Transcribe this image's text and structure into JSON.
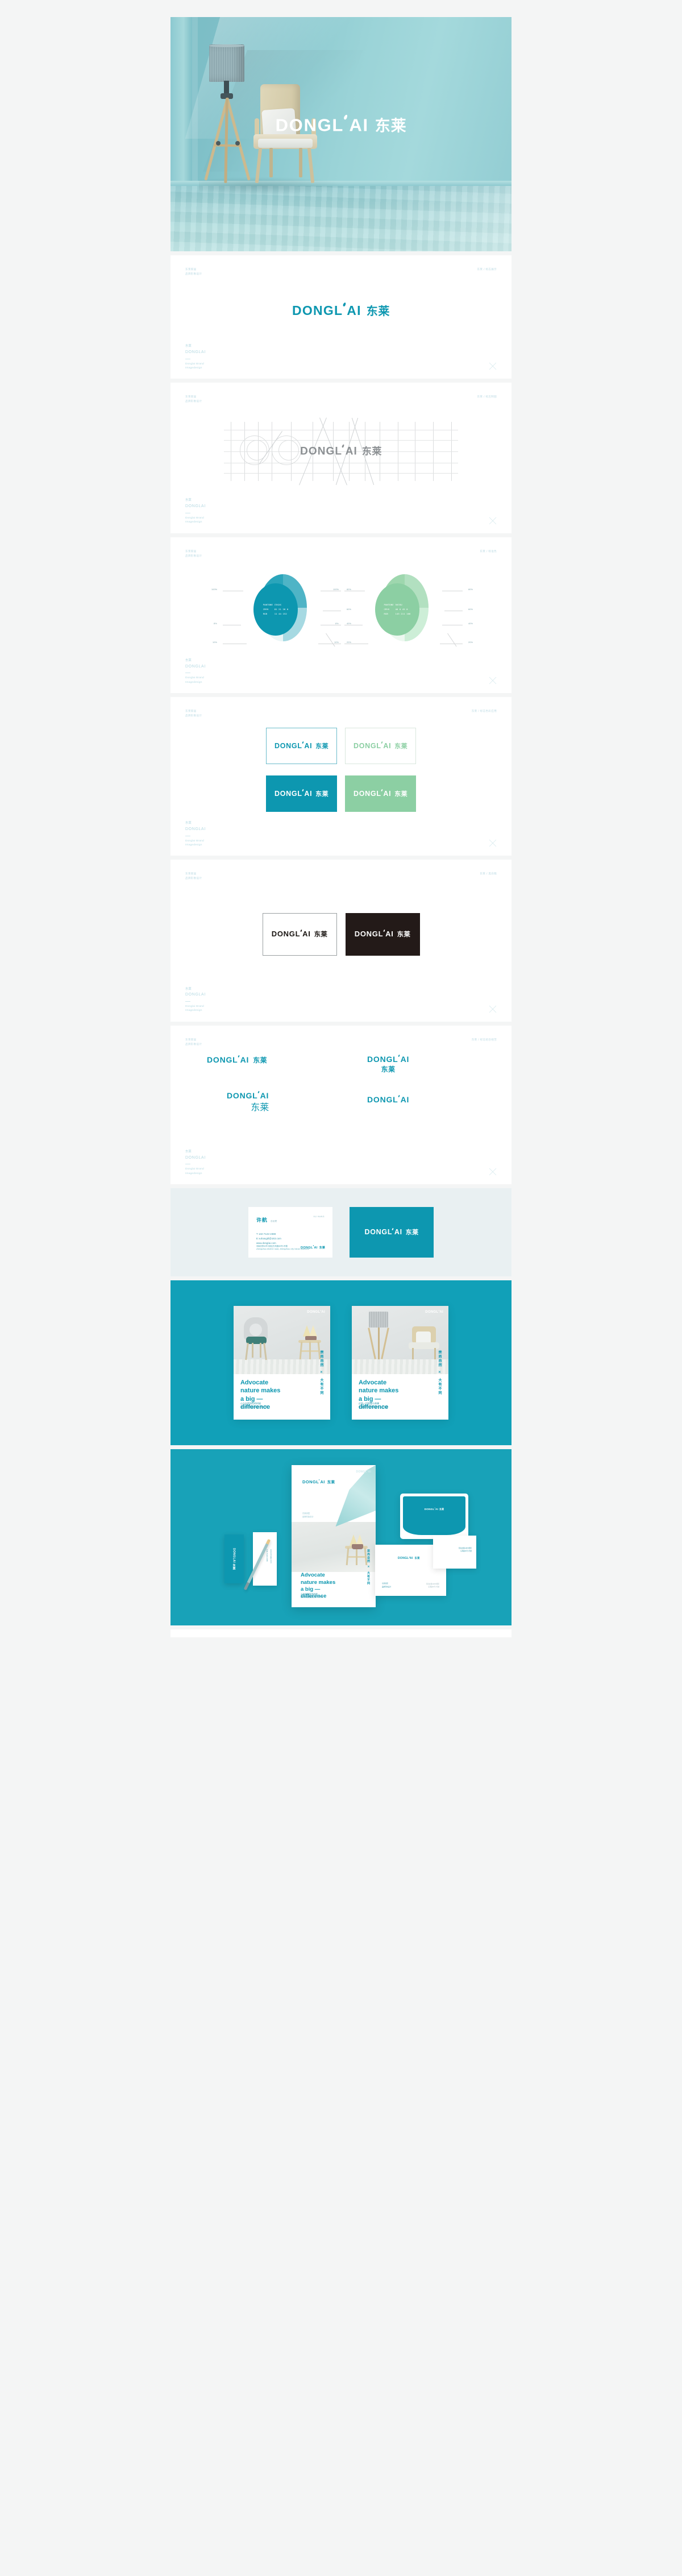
{
  "brand": {
    "latin": "DONGLAI",
    "cjk": "东莱",
    "accent_teal": "#0d97b0",
    "accent_green": "#8ccfa3",
    "dark": "#231a18",
    "page_bg": "#f4f5f5"
  },
  "hero": {
    "logo_latin": "DONGLAI",
    "logo_cjk": "东莱",
    "alt": "teal interior room with floor lamp and armchair"
  },
  "sheet_header": {
    "left_line1": "东莱家居",
    "left_line2": "品牌形象设计",
    "right_logo": "东莱 / 标志展示",
    "right_grid": "东莱 / 标志制图",
    "right_color": "东莱 / 标准色",
    "right_variants": "东莱 / 标志色彩应用",
    "right_bw": "东莱 / 黑白稿",
    "right_lockup": "东莱 / 标志组合规范"
  },
  "sheet_footer": {
    "cn": "东莱",
    "en": "DONGLAI",
    "sub_line1": "Donglai Brand",
    "sub_line2": "Imagedesign",
    "mark": "x-mark-icon"
  },
  "panels": {
    "logo": {
      "title": "标志展示"
    },
    "grid": {
      "title": "标志制图"
    },
    "color": {
      "title": "标准色",
      "swatches": [
        {
          "name": "primary-teal",
          "hex": "#0d97b0",
          "pantone_label": "PANTONE",
          "pantone_value": "C9XXX",
          "cmyk_label": "CMYK",
          "cmyk_value": "81 21 26 0",
          "rgb_label": "RGB",
          "rgb_value": "11 44 152",
          "left_ticks": [
            "100%",
            "8%",
            "10%"
          ],
          "right_ticks": [
            "80%",
            "60%",
            "40%",
            "20%"
          ]
        },
        {
          "name": "secondary-green",
          "hex": "#8ccfa3",
          "pantone_label": "PANTONE",
          "pantone_value": "5635U",
          "cmyk_label": "CMYK",
          "cmyk_value": "46 0 45 0",
          "rgb_label": "RGB",
          "rgb_value": "145 211 166",
          "left_ticks": [
            "100%",
            "8%",
            "10%"
          ],
          "right_ticks": [
            "80%",
            "60%",
            "40%",
            "20%"
          ]
        }
      ]
    },
    "variants": {
      "title": "标志色彩应用",
      "boxes": [
        {
          "name": "teal-on-white",
          "bg": "#ffffff",
          "fg": "#0d97b0",
          "border": "#6bbccb"
        },
        {
          "name": "green-on-white",
          "bg": "#ffffff",
          "fg": "#8ccfa3",
          "border": "#d9e7dd"
        },
        {
          "name": "white-on-teal",
          "bg": "#0d97b0",
          "fg": "#ffffff",
          "border": "transparent"
        },
        {
          "name": "white-on-green",
          "bg": "#8ccfa3",
          "fg": "#ffffff",
          "border": "transparent"
        }
      ]
    },
    "bw": {
      "title": "黑白稿",
      "boxes": [
        {
          "name": "black-on-white",
          "bg": "#ffffff",
          "fg": "#1a1512",
          "border": "#9aa0a2"
        },
        {
          "name": "white-on-black",
          "bg": "#231a18",
          "fg": "#ffffff",
          "border": "transparent"
        }
      ]
    },
    "lockups": {
      "title": "标志组合规范",
      "items": [
        {
          "name": "horizontal-lockup",
          "layout": "horizontal",
          "latin": "DONGLAI",
          "cjk": "东莱"
        },
        {
          "name": "stacked-centered-lockup",
          "layout": "stacked",
          "latin": "DONGLAI",
          "cjk": "东莱"
        },
        {
          "name": "stacked-right-lockup",
          "layout": "stacked-right",
          "latin": "DONGLAI",
          "cjk": "东莱"
        },
        {
          "name": "latin-only-lockup",
          "layout": "latin-only",
          "latin": "DONGLAI",
          "cjk": ""
        }
      ]
    },
    "business_card": {
      "name_cjk": "许航",
      "role": "总经理",
      "name_pinyin": "XU HANG",
      "phone": "T  132-7122-2388",
      "email": "E  xuhangdl@163.com",
      "website": "www.donglai.com",
      "address_cn": "河南省郑州市中原区东风路66号1号楼",
      "address_en": "zhengzhou district road, zhengzhou city henan province",
      "back_latin": "DONGLAI",
      "back_cjk": "东莱"
    },
    "posters": {
      "headline_line1": "Advocate",
      "headline_line2": "nature makes",
      "headline_line3": "a big —",
      "headline_line4": "difference",
      "vertical_left": "崇尚自然",
      "vertical_x": "×",
      "vertical_right": "大有不同",
      "logo": "DONGLAI",
      "items": [
        {
          "name": "poster-chair",
          "sub_line1": "心与自然同在的时候",
          "sub_line2": "我们永远都会找到一种宁静"
        },
        {
          "name": "poster-lamp",
          "sub_line1": "远离一切喧嚣与束缚",
          "sub_line2": "在慢慢的世界里保持几分宁静"
        }
      ]
    },
    "stationery": {
      "flyer_logo_latin": "DONGLAI",
      "flyer_logo_cjk": "东莱",
      "flyer_headline_line1": "Advocate",
      "flyer_headline_line2": "nature makes",
      "flyer_headline_line3": "a big —",
      "flyer_headline_line4": "difference",
      "flyer_sub_line1": "心与自然同在的时候",
      "flyer_sub_line2": "我们永远都会找到一种宁静",
      "flyer_vertical_left": "崇尚自然",
      "flyer_vertical_x": "×",
      "flyer_vertical_right": "大有不同",
      "card_vertical": "DONGLAI 东莱",
      "envelope_latin": "DONGLAI",
      "envelope_cjk": "东莱",
      "sheet_logo_latin": "DONGLAI",
      "sheet_logo_cjk": "东莱",
      "sheet_left_note": "东莱家居\n品牌形象设计",
      "sheet_right_note": "河南省郑州市中原区\n东风路66号1号楼",
      "card3_note": "www.donglai.com\n132-7122-2388"
    }
  }
}
